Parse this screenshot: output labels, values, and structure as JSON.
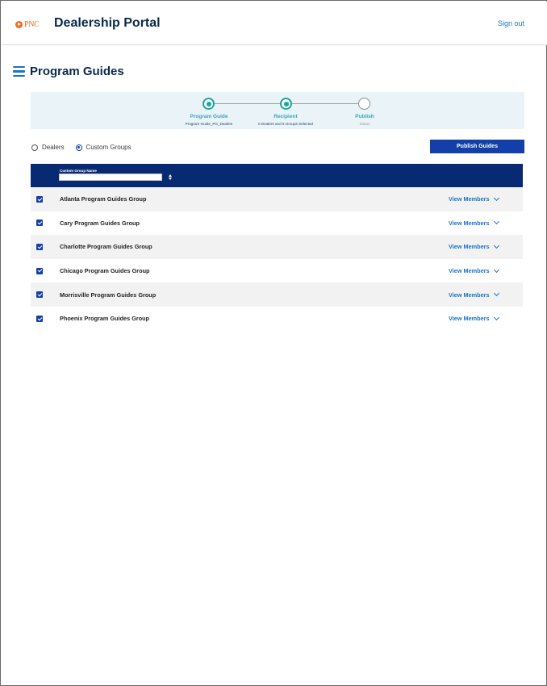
{
  "header": {
    "logo_text": "PNC",
    "app_title": "Dealership Portal",
    "signout_label": "Sign out"
  },
  "page": {
    "title": "Program Guides"
  },
  "stepper": {
    "steps": [
      {
        "label": "Program Guide",
        "sub": "Program Guide_PG_Dealers",
        "state": "complete"
      },
      {
        "label": "Recipient",
        "sub": "0 Dealers and 6 Groups Selected",
        "state": "complete"
      },
      {
        "label": "Publish",
        "sub": "Status",
        "state": "pending"
      }
    ],
    "colors": {
      "complete": "#1aa79a",
      "pending": "#8a8a8a",
      "background": "#eaf4f8"
    }
  },
  "recipient_type": {
    "options": [
      "Dealers",
      "Custom Groups"
    ],
    "selected": "Custom Groups"
  },
  "actions": {
    "publish_label": "Publish Guides"
  },
  "table": {
    "column_header": "Custom Group Name",
    "filter_value": "",
    "view_label": "View Members",
    "rows": [
      {
        "name": "Atlanta Program Guides Group",
        "checked": true
      },
      {
        "name": "Cary Program Guides Group",
        "checked": true
      },
      {
        "name": "Charlotte Program Guides Group",
        "checked": true
      },
      {
        "name": "Chicago Program Guides Group",
        "checked": true
      },
      {
        "name": "Morrisville Program Guides Group",
        "checked": true
      },
      {
        "name": "Phoenix Program Guides Group",
        "checked": true
      }
    ]
  },
  "colors": {
    "brand_orange": "#ef6a22",
    "navy": "#072a73",
    "primary_blue": "#1340a8",
    "link_blue": "#1a73c6"
  }
}
